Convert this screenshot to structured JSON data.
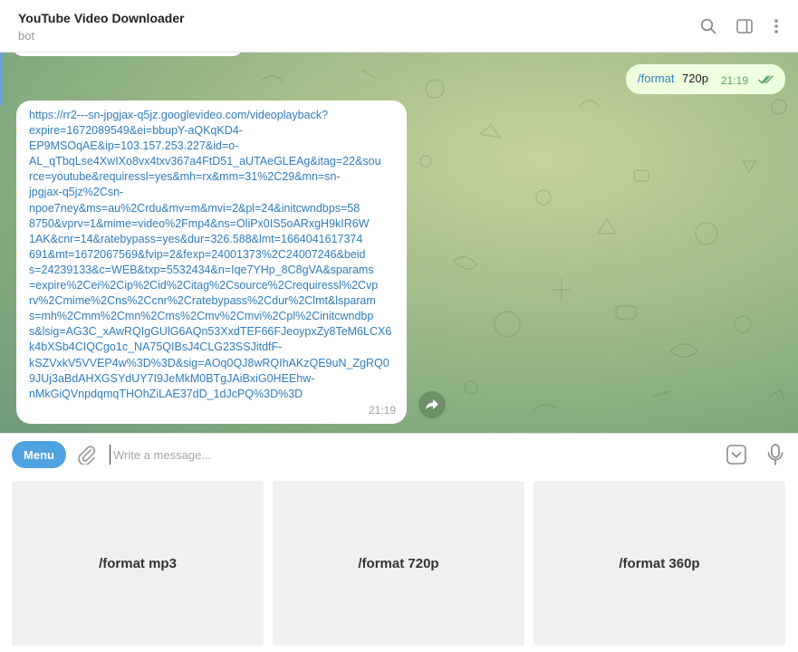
{
  "header": {
    "title": "YouTube Video Downloader",
    "subtitle": "bot",
    "icons": [
      "search-icon",
      "sidebar-toggle-icon",
      "more-vertical-icon"
    ]
  },
  "messages": {
    "outgoing": {
      "command": "/format",
      "argument": "720p",
      "time": "21:19",
      "status": "read"
    },
    "incoming": {
      "text": "https://rr2---sn-jpgjax-q5jz.googlevideo.com/videoplayback?\nexpire=1672089549&ei=bbupY-aQKqKD4-\nEP9MSOqAE&ip=103.157.253.227&id=o-\nAL_qTbqLse4XwIXo8vx4txv367a4FtD51_aUTAeGLEAg&itag=22&sou\nrce=youtube&requiressl=yes&mh=rx&mm=31%2C29&mn=sn-\njpgjax-q5jz%2Csn-\nnpoe7ney&ms=au%2Crdu&mv=m&mvi=2&pl=24&initcwndbps=58\n8750&vprv=1&mime=video%2Fmp4&ns=OliPx0IS5oARxgH9kIR6W\n1AK&cnr=14&ratebypass=yes&dur=326.588&lmt=1664041617374\n691&mt=1672067569&fvip=2&fexp=24001373%2C24007246&beid\ns=24239133&c=WEB&txp=5532434&n=Iqe7YHp_8C8gVA&sparams\n=expire%2Cei%2Cip%2Cid%2Citag%2Csource%2Crequiressl%2Cvp\nrv%2Cmime%2Cns%2Ccnr%2Cratebypass%2Cdur%2Clmt&lsparam\ns=mh%2Cmm%2Cmn%2Cms%2Cmv%2Cmvi%2Cpl%2Cinitcwndbp\ns&lsig=AG3C_xAwRQIgGUlG6AQn53XxdTEF66FJeoypxZy8TeM6LCX6\nk4bXSb4CIQCgo1c_NA75QIBsJ4CLG23SSJitdfF-\nkSZVxkV5VVEP4w%3D%3D&sig=AOq0QJ8wRQIhAKzQE9uN_ZgRQ0\n9JUj3aBdAHXGSYdUY7I9JeMkM0BTgJAiBxiG0HEEhw-\nnMkGiQVnpdqmqTHOhZiLAE37dD_1dJcPQ%3D%3D",
      "time": "21:19"
    }
  },
  "composer": {
    "menu_label": "Menu",
    "placeholder": "Write a message..."
  },
  "keyboard": {
    "buttons": [
      "/format mp3",
      "/format 720p",
      "/format 360p"
    ]
  },
  "colors": {
    "accent": "#50a2e0",
    "link": "#2e7db9",
    "outgoing_bubble": "#eeffde",
    "read_check": "#5aa55f"
  }
}
